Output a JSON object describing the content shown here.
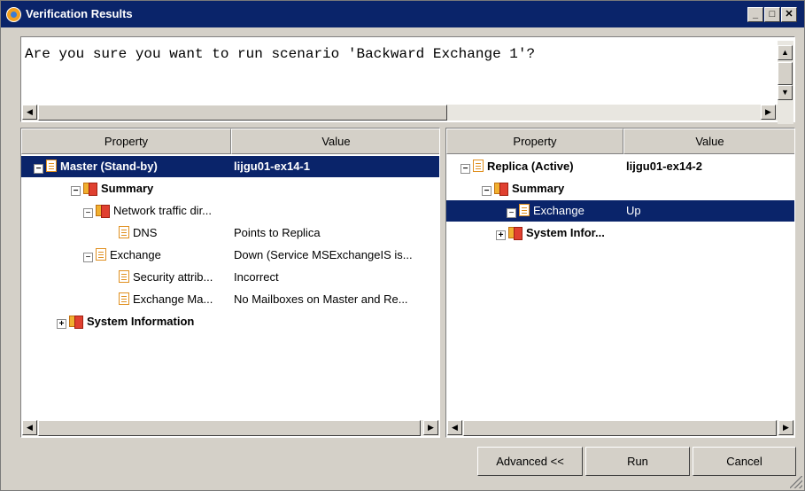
{
  "window": {
    "title": "Verification Results",
    "min_glyph": "_",
    "max_glyph": "□",
    "close_glyph": "✕"
  },
  "message": {
    "text": "Are you sure you want to run scenario 'Backward Exchange 1'?"
  },
  "scroll_glyphs": {
    "up": "▲",
    "down": "▼",
    "left": "◀",
    "right": "▶"
  },
  "master": {
    "headers": {
      "property": "Property",
      "value": "Value"
    },
    "rows": [
      {
        "property": "Master (Stand-by)",
        "value": "lijgu01-ex14-1",
        "expander": "-",
        "icon": "doc-icon"
      },
      {
        "property": "Summary",
        "value": "",
        "expander": "-",
        "icon": "folder-icon"
      },
      {
        "property": "Network traffic dir...",
        "value": "",
        "expander": "-",
        "icon": "folder-icon"
      },
      {
        "property": "DNS",
        "value": "Points to Replica",
        "expander": "",
        "icon": "doc-icon"
      },
      {
        "property": "Exchange",
        "value": "Down (Service MSExchangeIS is...",
        "expander": "-",
        "icon": "doc-icon"
      },
      {
        "property": "Security attrib...",
        "value": "Incorrect",
        "expander": "",
        "icon": "doc-icon"
      },
      {
        "property": "Exchange Ma...",
        "value": "No Mailboxes on Master and Re...",
        "expander": "",
        "icon": "doc-icon"
      },
      {
        "property": "System Information",
        "value": "",
        "expander": "+",
        "icon": "folder-icon"
      }
    ]
  },
  "replica": {
    "headers": {
      "property": "Property",
      "value": "Value"
    },
    "rows": [
      {
        "property": "Replica (Active)",
        "value": "lijgu01-ex14-2",
        "expander": "-",
        "icon": "doc-icon"
      },
      {
        "property": "Summary",
        "value": "",
        "expander": "-",
        "icon": "folder-icon"
      },
      {
        "property": "Exchange",
        "value": "Up",
        "expander": "-",
        "icon": "doc-icon"
      },
      {
        "property": "System Infor...",
        "value": "",
        "expander": "+",
        "icon": "folder-icon"
      }
    ]
  },
  "buttons": {
    "advanced": "Advanced <<",
    "run": "Run",
    "cancel": "Cancel"
  }
}
